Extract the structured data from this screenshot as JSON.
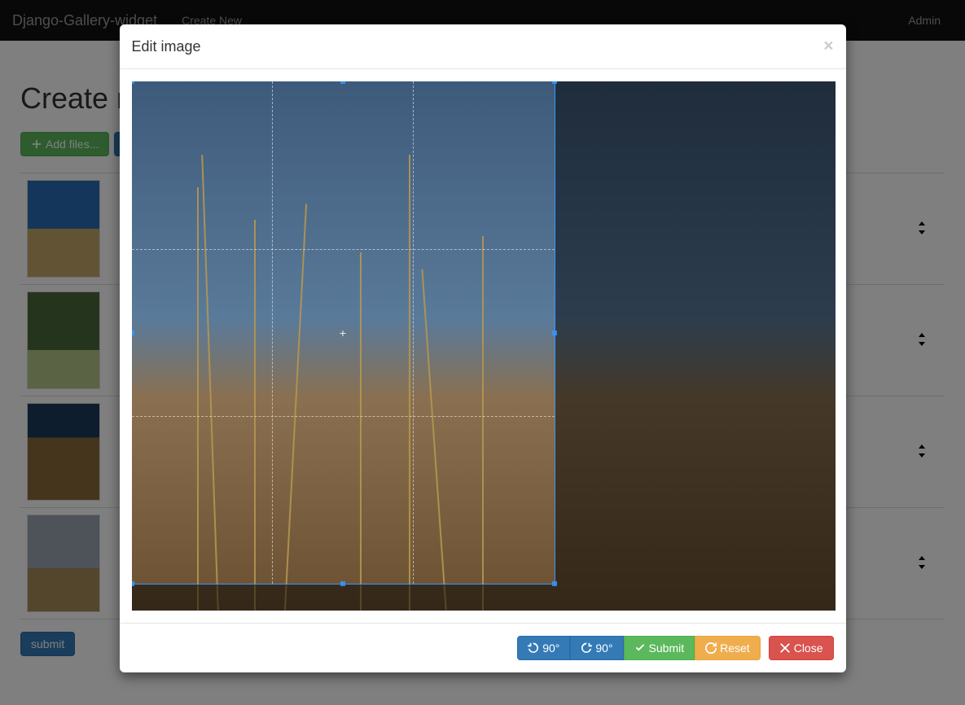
{
  "navbar": {
    "brand": "Django-Gallery-widget",
    "create_new": "Create New",
    "admin": "Admin"
  },
  "page": {
    "heading": "Create new gallery"
  },
  "toolbar": {
    "add_files": "Add files..."
  },
  "submit_label": "submit",
  "modal": {
    "title": "Edit image",
    "close_symbol": "×",
    "rotate_ccw": "90°",
    "rotate_cw": "90°",
    "submit": "Submit",
    "reset": "Reset",
    "close": "Close"
  }
}
